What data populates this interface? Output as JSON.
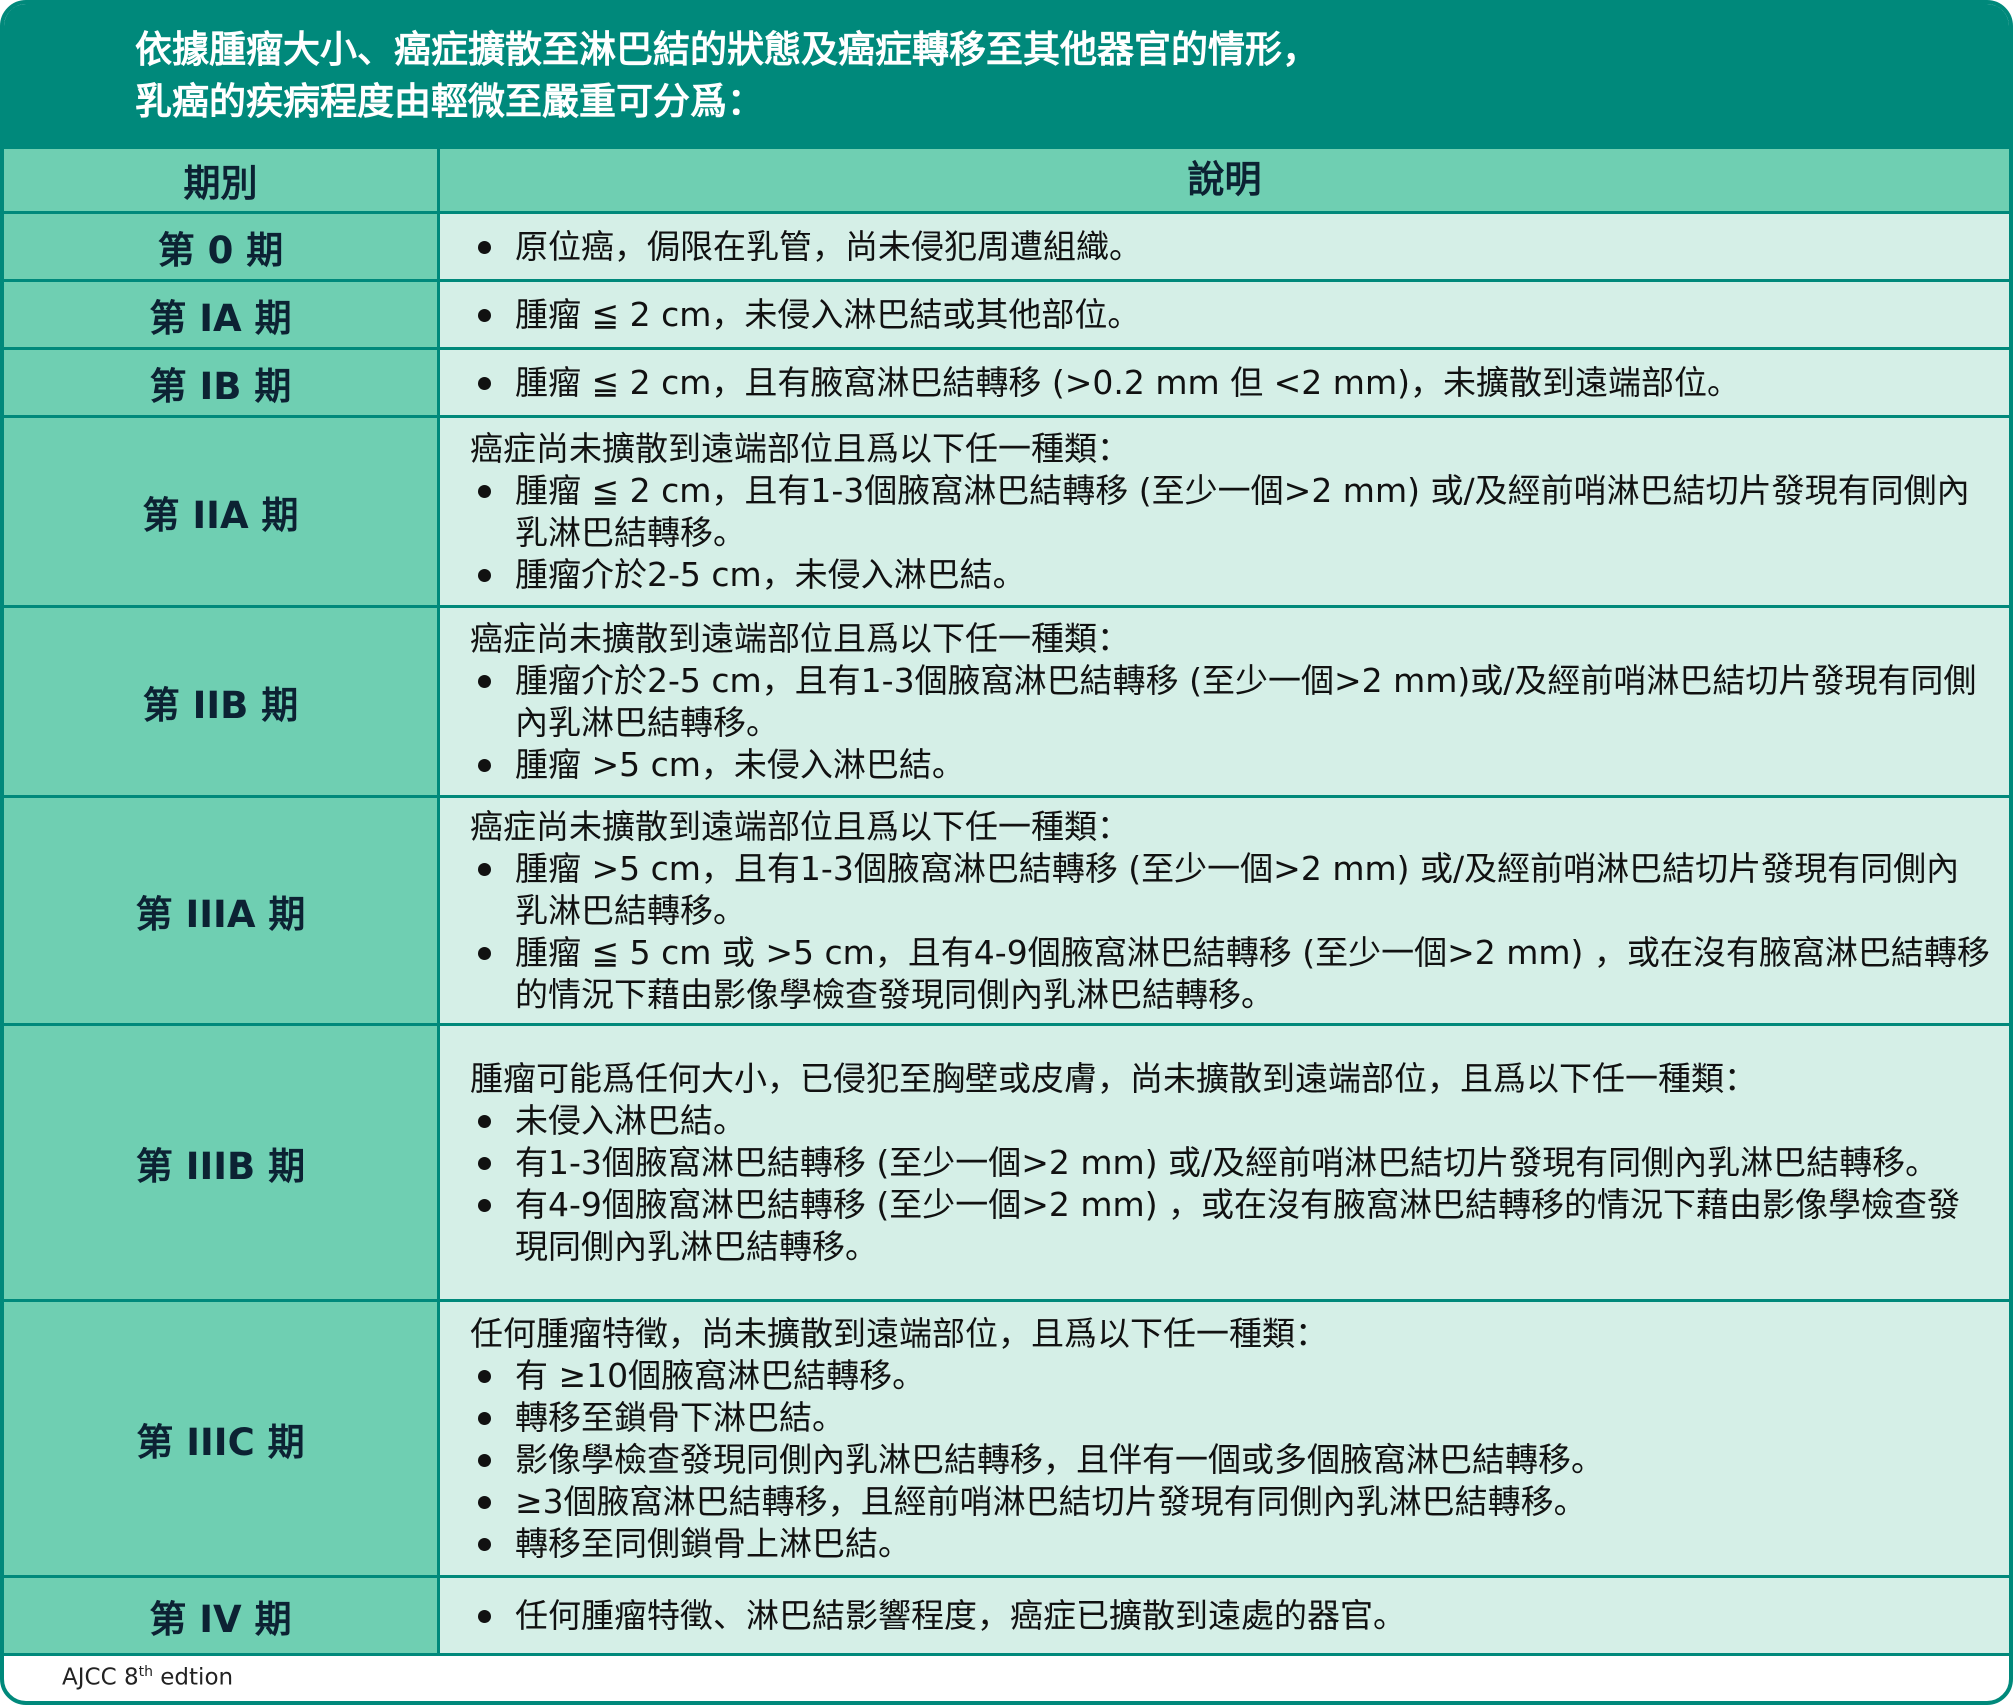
{
  "title": {
    "line1": "依據腫瘤大小、癌症擴散至淋巴結的狀態及癌症轉移至其他器官的情形，",
    "line2": "乳癌的疾病程度由輕微至嚴重可分爲："
  },
  "table": {
    "headers": {
      "stage": "期別",
      "description": "說明"
    },
    "rows": [
      {
        "stage": "第 0 期",
        "bullets": [
          "原位癌，侷限在乳管，尚未侵犯周遭組織。"
        ]
      },
      {
        "stage": "第 IA 期",
        "bullets": [
          "腫瘤 ≦ 2 cm，未侵入淋巴結或其他部位。"
        ]
      },
      {
        "stage": "第 IB 期",
        "bullets": [
          "腫瘤 ≦ 2 cm，且有腋窩淋巴結轉移 (>0.2 mm 但 <2 mm)，未擴散到遠端部位。"
        ]
      },
      {
        "stage": "第 IIA 期",
        "intro": "癌症尚未擴散到遠端部位且爲以下任一種類：",
        "bullets": [
          "腫瘤 ≦ 2 cm，且有1-3個腋窩淋巴結轉移 (至少一個>2 mm) 或/及經前哨淋巴結切片發現有同側內乳淋巴結轉移。",
          "腫瘤介於2-5 cm，未侵入淋巴結。"
        ]
      },
      {
        "stage": "第 IIB 期",
        "intro": "癌症尚未擴散到遠端部位且爲以下任一種類：",
        "bullets": [
          "腫瘤介於2-5 cm，且有1-3個腋窩淋巴結轉移 (至少一個>2 mm)或/及經前哨淋巴結切片發現有同側內乳淋巴結轉移。",
          "腫瘤 >5 cm，未侵入淋巴結。"
        ]
      },
      {
        "stage": "第 IIIA 期",
        "intro": "癌症尚未擴散到遠端部位且爲以下任一種類：",
        "bullets": [
          "腫瘤 >5 cm，且有1-3個腋窩淋巴結轉移 (至少一個>2 mm) 或/及經前哨淋巴結切片發現有同側內乳淋巴結轉移。",
          "腫瘤 ≦ 5 cm 或 >5 cm，且有4-9個腋窩淋巴結轉移 (至少一個>2 mm) ，或在沒有腋窩淋巴結轉移的情況下藉由影像學檢查發現同側內乳淋巴結轉移。"
        ]
      },
      {
        "stage": "第 IIIB 期",
        "intro": "腫瘤可能爲任何大小，已侵犯至胸壁或皮膚，尚未擴散到遠端部位，且爲以下任一種類：",
        "bullets": [
          "未侵入淋巴結。",
          "有1-3個腋窩淋巴結轉移 (至少一個>2 mm) 或/及經前哨淋巴結切片發現有同側內乳淋巴結轉移。",
          "有4-9個腋窩淋巴結轉移 (至少一個>2 mm) ，或在沒有腋窩淋巴結轉移的情況下藉由影像學檢查發現同側內乳淋巴結轉移。"
        ]
      },
      {
        "stage": "第 IIIC 期",
        "intro": "任何腫瘤特徵，尚未擴散到遠端部位，且爲以下任一種類：",
        "bullets": [
          "有 ≥10個腋窩淋巴結轉移。",
          "轉移至鎖骨下淋巴結。",
          "影像學檢查發現同側內乳淋巴結轉移，且伴有一個或多個腋窩淋巴結轉移。",
          "≥3個腋窩淋巴結轉移，且經前哨淋巴結切片發現有同側內乳淋巴結轉移。",
          "轉移至同側鎖骨上淋巴結。"
        ]
      },
      {
        "stage": "第 IV 期",
        "bullets": [
          "任何腫瘤特徵、淋巴結影響程度，癌症已擴散到遠處的器官。"
        ]
      }
    ]
  },
  "footnote": {
    "prefix": "AJCC 8",
    "superscript": "th",
    "suffix": " edtion"
  },
  "colors": {
    "header_bg": "#00897b",
    "stage_cell_bg": "#6fcfb2",
    "desc_cell_bg": "#d5efe7",
    "border": "#00897b"
  }
}
